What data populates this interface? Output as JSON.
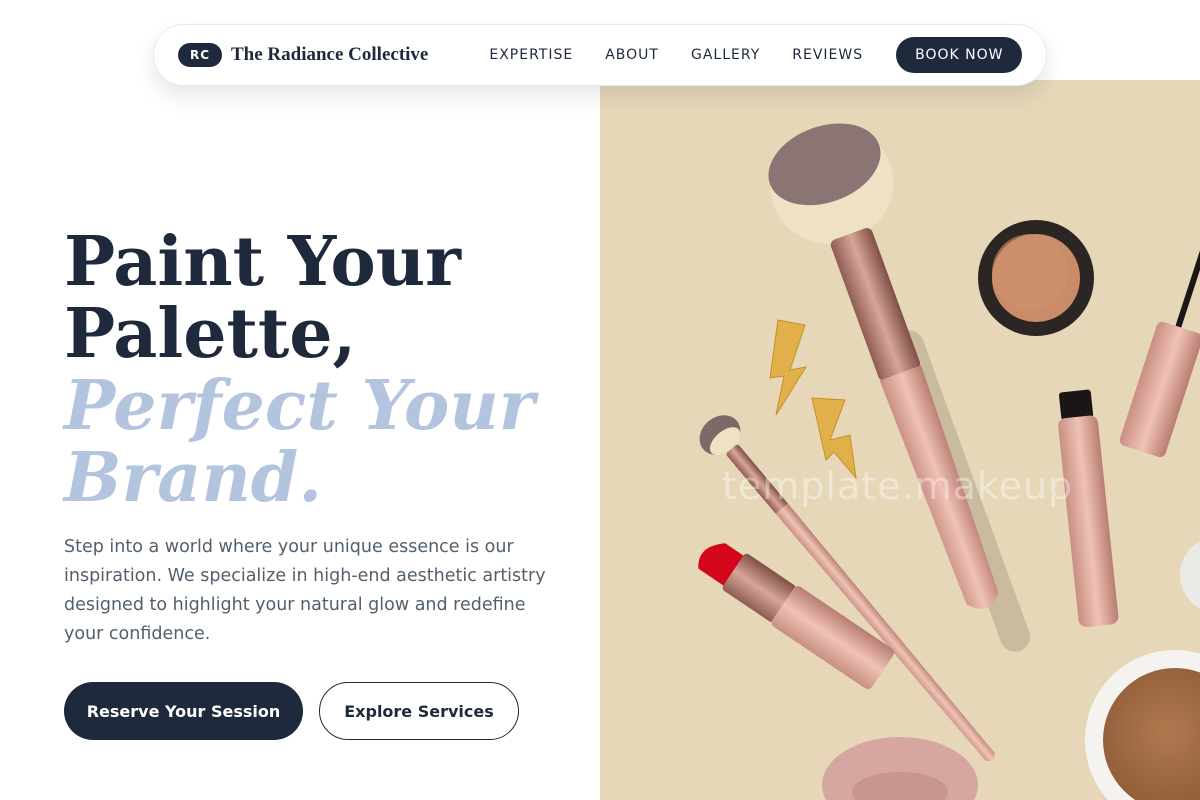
{
  "brand": {
    "initials": "RC",
    "name": "The Radiance Collective"
  },
  "nav": {
    "links": [
      "EXPERTISE",
      "ABOUT",
      "GALLERY",
      "REVIEWS"
    ],
    "cta_label": "BOOK NOW"
  },
  "hero": {
    "headline_line1": "Paint Your",
    "headline_line2": "Palette,",
    "accent_line1": "Perfect Your",
    "accent_line2": "Brand.",
    "body": "Step into a world where your unique essence is our inspiration. We specialize in high-end aesthetic artistry designed to highlight your natural glow and redefine your confidence.",
    "primary_cta": "Reserve Your Session",
    "secondary_cta": "Explore Services"
  },
  "image": {
    "watermark": "template.makeup"
  },
  "colors": {
    "navy": "#1e293b",
    "accent_blue": "#b3c5de",
    "beige_bg": "#e6d7b8",
    "rose_gold": "#d9a59a"
  }
}
